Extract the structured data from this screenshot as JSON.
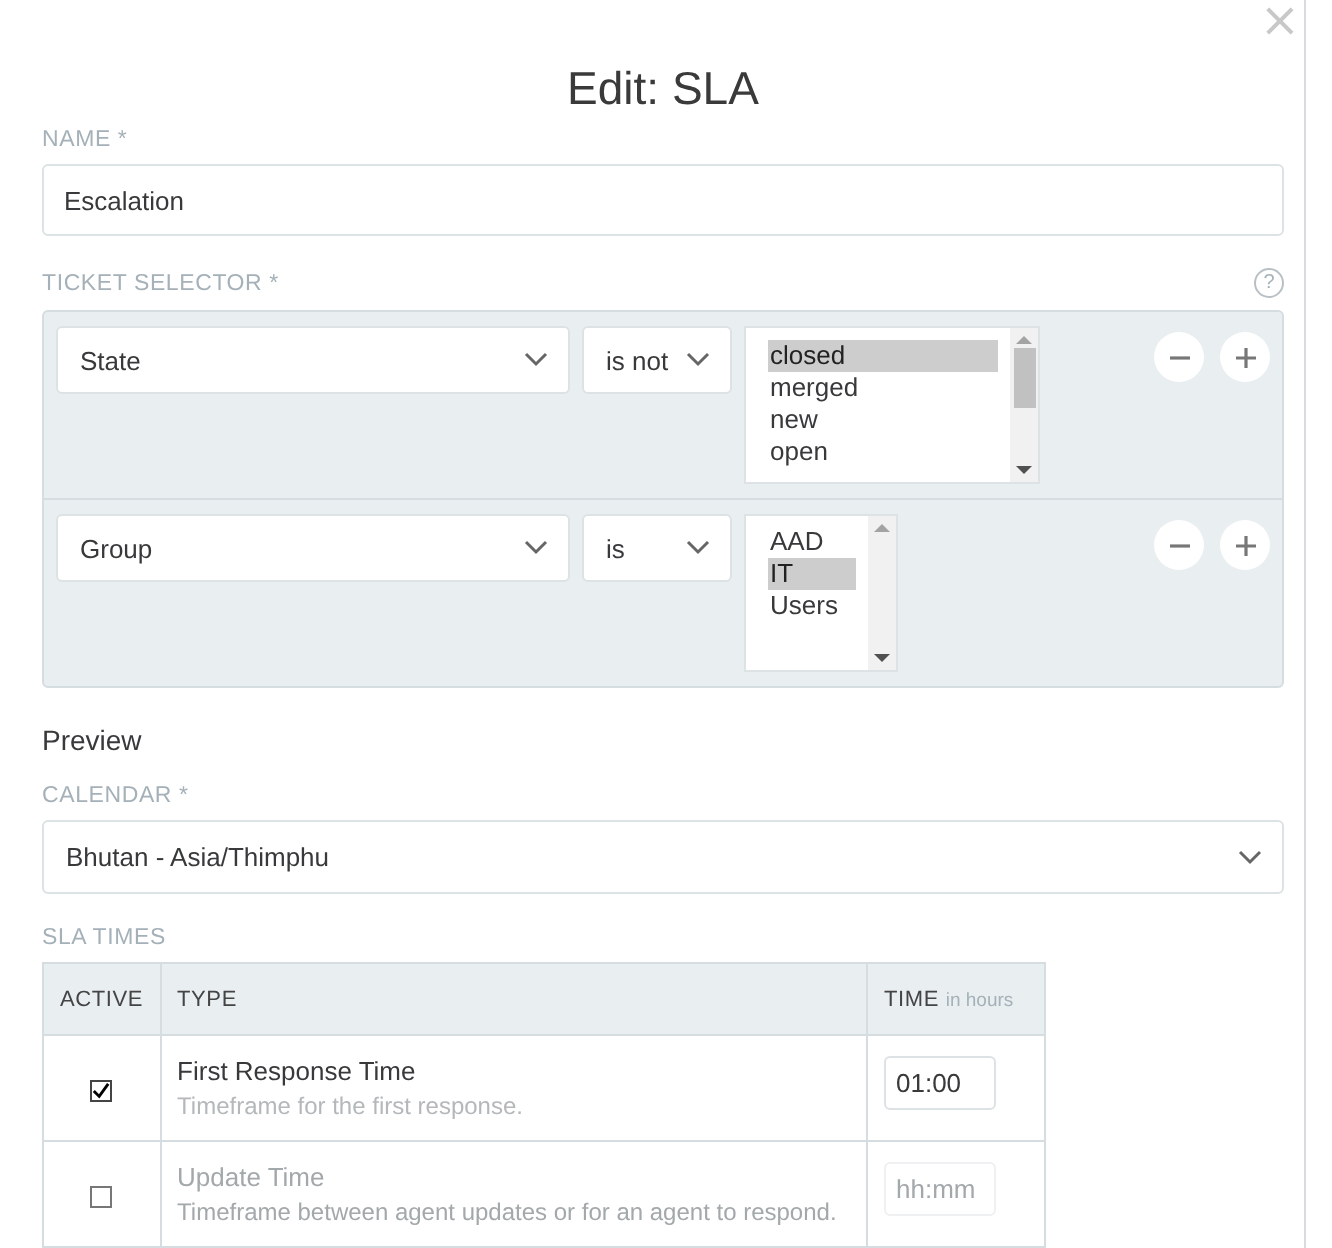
{
  "modal": {
    "title": "Edit: SLA",
    "close": "×"
  },
  "name_field": {
    "label": "NAME *",
    "value": "Escalation"
  },
  "ticket_selector": {
    "label": "TICKET SELECTOR *",
    "help": "?",
    "conditions": [
      {
        "attribute": "State",
        "operator": "is not",
        "options": [
          {
            "label": "closed",
            "selected": true
          },
          {
            "label": "merged",
            "selected": false
          },
          {
            "label": "new",
            "selected": false
          },
          {
            "label": "open",
            "selected": false
          }
        ],
        "wide": true
      },
      {
        "attribute": "Group",
        "operator": "is",
        "options": [
          {
            "label": "AAD",
            "selected": false
          },
          {
            "label": "IT",
            "selected": true
          },
          {
            "label": "Users",
            "selected": false
          }
        ],
        "wide": false
      }
    ]
  },
  "preview": {
    "heading": "Preview"
  },
  "calendar": {
    "label": "CALENDAR *",
    "value": "Bhutan - Asia/Thimphu"
  },
  "sla_times": {
    "label": "SLA TIMES",
    "columns": {
      "active": "ACTIVE",
      "type": "TYPE",
      "time": "TIME",
      "time_hint": "in hours"
    },
    "rows": [
      {
        "title": "First Response Time",
        "description": "Timeframe for the first response.",
        "checked": true,
        "value": "01:00"
      },
      {
        "title": "Update Time",
        "description": "Timeframe between agent updates or for an agent to respond.",
        "checked": false,
        "placeholder": "hh:mm"
      }
    ]
  }
}
